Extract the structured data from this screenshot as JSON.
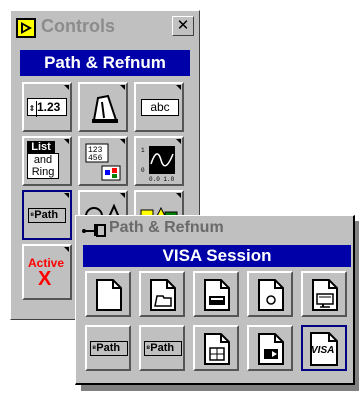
{
  "controls_palette": {
    "title": "Controls",
    "close_glyph": "✕",
    "subpalette_title": "Path & Refnum",
    "items": [
      {
        "icon": "digital-control-icon",
        "text": "1.23"
      },
      {
        "icon": "slide-control-icon"
      },
      {
        "icon": "string-control-icon",
        "text": "abc"
      },
      {
        "icon": "list-ring-icon",
        "text_lines": [
          "List",
          "and",
          "Ring"
        ]
      },
      {
        "icon": "array-cluster-icon"
      },
      {
        "icon": "graph-icon"
      },
      {
        "icon": "path-refnum-icon",
        "text": "Path"
      },
      {
        "icon": "decorations-icon"
      },
      {
        "icon": "boolean-icon"
      },
      {
        "icon": "activex-icon",
        "text": "Active"
      }
    ]
  },
  "visa_palette": {
    "title": "Path & Refnum",
    "pin_glyph": "•─⊣⊢",
    "banner": "VISA Session",
    "items": [
      {
        "icon": "file-refnum-icon"
      },
      {
        "icon": "directory-refnum-icon"
      },
      {
        "icon": "device-refnum-icon"
      },
      {
        "icon": "occurrence-refnum-icon"
      },
      {
        "icon": "byte-stream-refnum-icon"
      },
      {
        "icon": "path-icon",
        "text": "Path"
      },
      {
        "icon": "path-ring-icon",
        "text": "Path"
      },
      {
        "icon": "datalog-refnum-icon"
      },
      {
        "icon": "application-refnum-icon"
      },
      {
        "icon": "visa-refnum-icon",
        "text": "VISA"
      }
    ]
  },
  "colors": {
    "panel": "#c0c0c0",
    "banner": "#0000a8",
    "selected_border": "#000080"
  }
}
